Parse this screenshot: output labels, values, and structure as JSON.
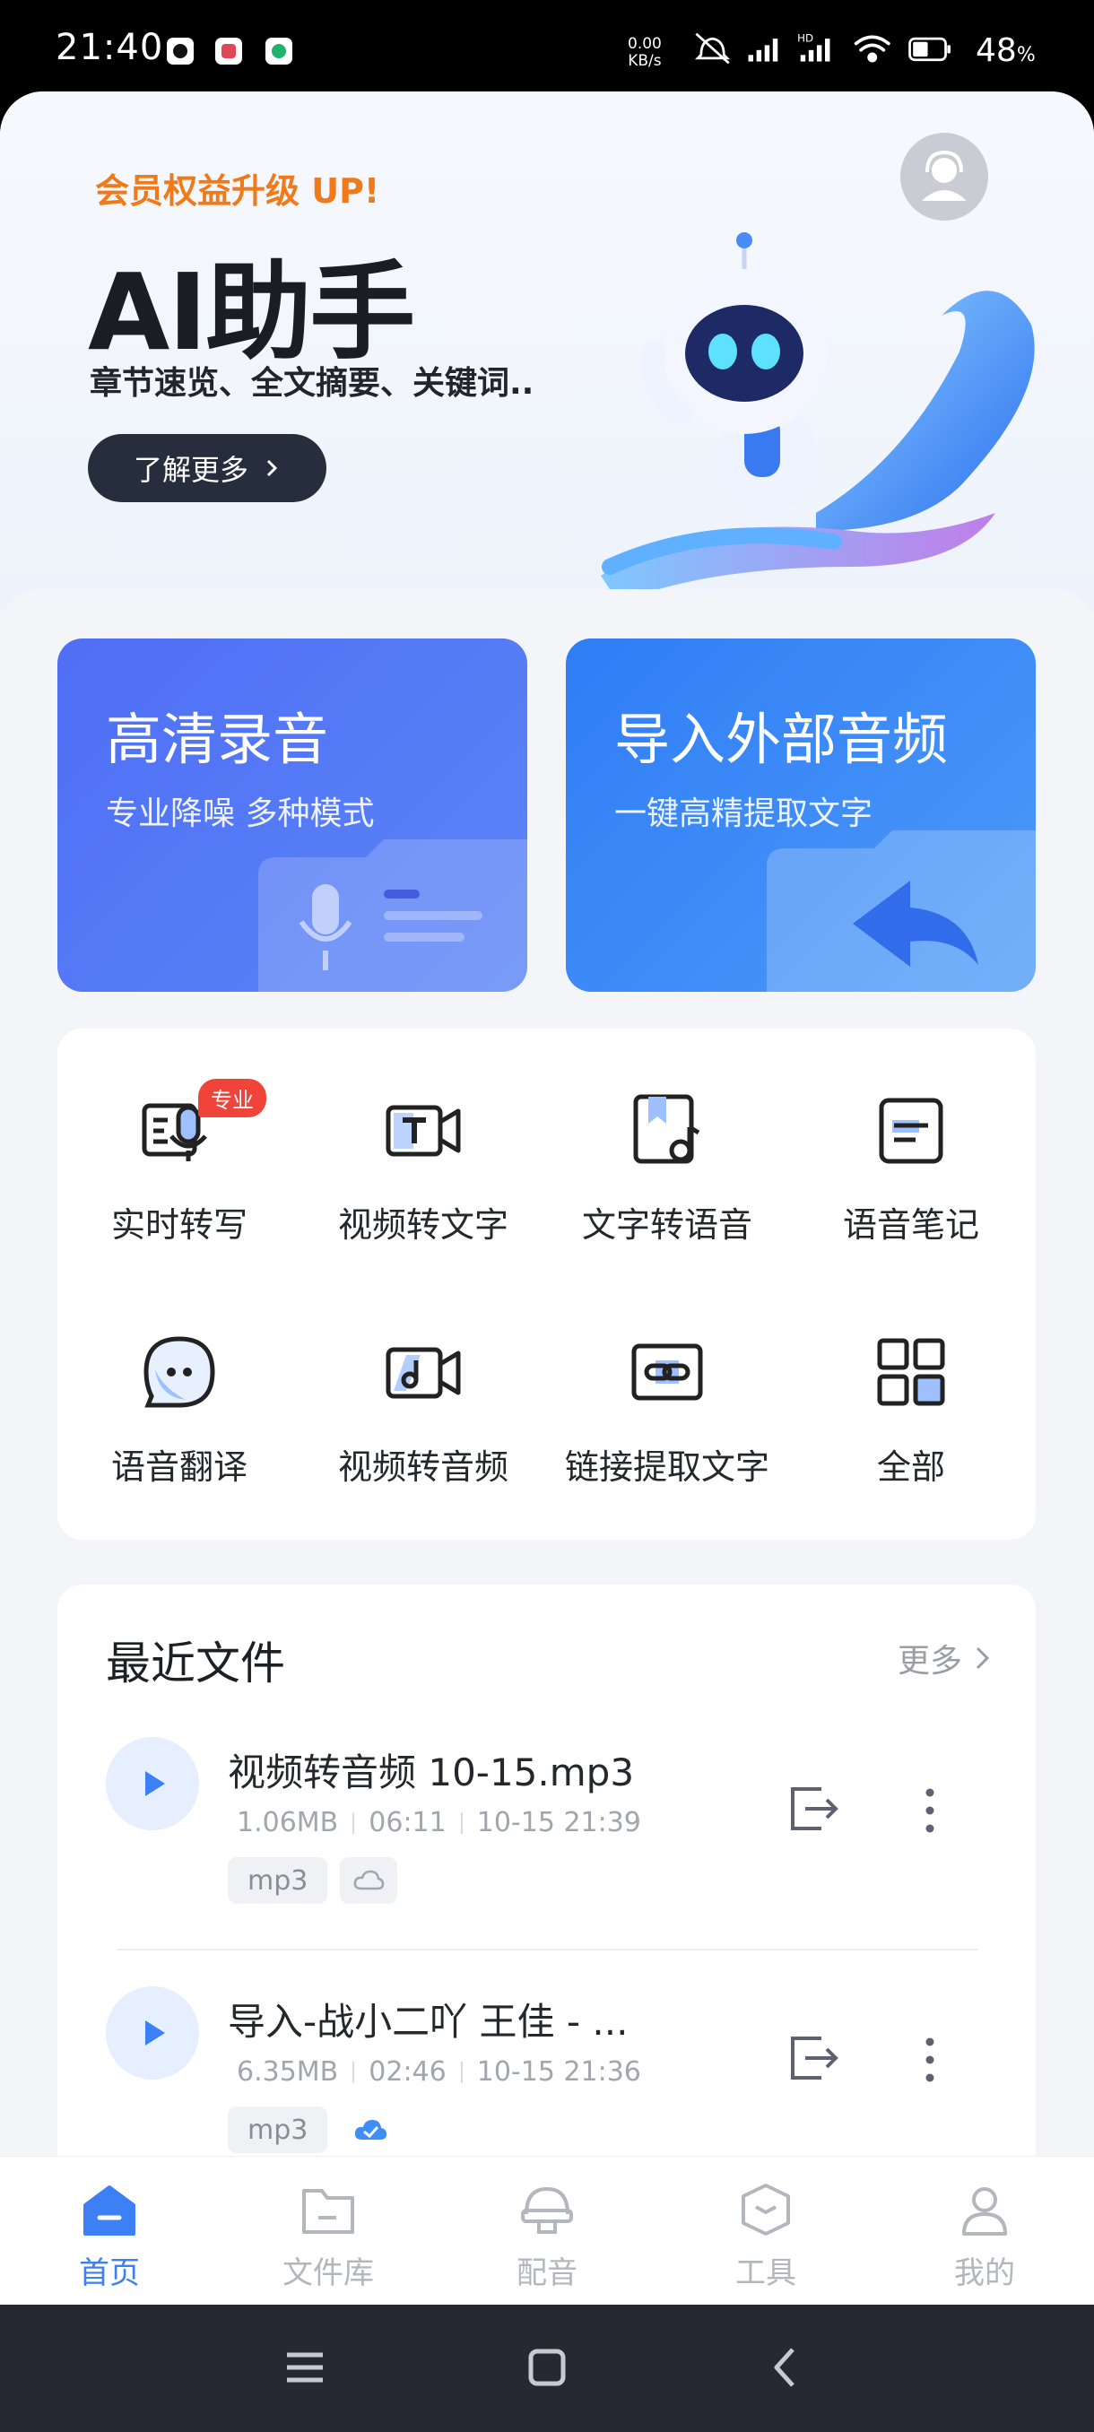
{
  "status_bar": {
    "time": "21:40",
    "net_speed_value": "0.00",
    "net_speed_unit": "KB/s",
    "hd_label": "HD",
    "battery_value": "48",
    "battery_unit": "%"
  },
  "hero": {
    "tag": "会员权益升级 UP!",
    "title": "AI助手",
    "subtitle": "章节速览、全文摘要、关键词..",
    "button_label": "了解更多"
  },
  "cards": [
    {
      "title": "高清录音",
      "subtitle": "专业降噪 多种模式"
    },
    {
      "title": "导入外部音频",
      "subtitle": "一键高精提取文字"
    }
  ],
  "tools": [
    {
      "label": "实时转写",
      "icon": "realtime-transcribe-icon",
      "badge": "专业"
    },
    {
      "label": "视频转文字",
      "icon": "video-to-text-icon"
    },
    {
      "label": "文字转语音",
      "icon": "text-to-speech-icon"
    },
    {
      "label": "语音笔记",
      "icon": "voice-note-icon"
    },
    {
      "label": "语音翻译",
      "icon": "voice-translate-icon"
    },
    {
      "label": "视频转音频",
      "icon": "video-to-audio-icon"
    },
    {
      "label": "链接提取文字",
      "icon": "link-extract-icon"
    },
    {
      "label": "全部",
      "icon": "grid-all-icon"
    }
  ],
  "recent": {
    "title": "最近文件",
    "more_label": "更多",
    "files": [
      {
        "name": "视频转音频 10-15.mp3",
        "size": "1.06MB",
        "duration": "06:11",
        "date": "10-15 21:39",
        "tag": "mp3",
        "cloud": "cloud-outline-icon"
      },
      {
        "name": "导入-战小二吖 王佳 - ...",
        "size": "6.35MB",
        "duration": "02:46",
        "date": "10-15 21:36",
        "tag": "mp3",
        "cloud": "cloud-check-icon"
      }
    ]
  },
  "bottom_nav": [
    {
      "label": "首页",
      "icon": "home-icon",
      "active": true
    },
    {
      "label": "文件库",
      "icon": "folder-icon"
    },
    {
      "label": "配音",
      "icon": "headset-icon"
    },
    {
      "label": "工具",
      "icon": "toolbox-icon"
    },
    {
      "label": "我的",
      "icon": "profile-icon"
    }
  ],
  "colors": {
    "accent": "#3d7ff5",
    "hero_tag": "#f07a1a",
    "badge": "#f0433a"
  }
}
